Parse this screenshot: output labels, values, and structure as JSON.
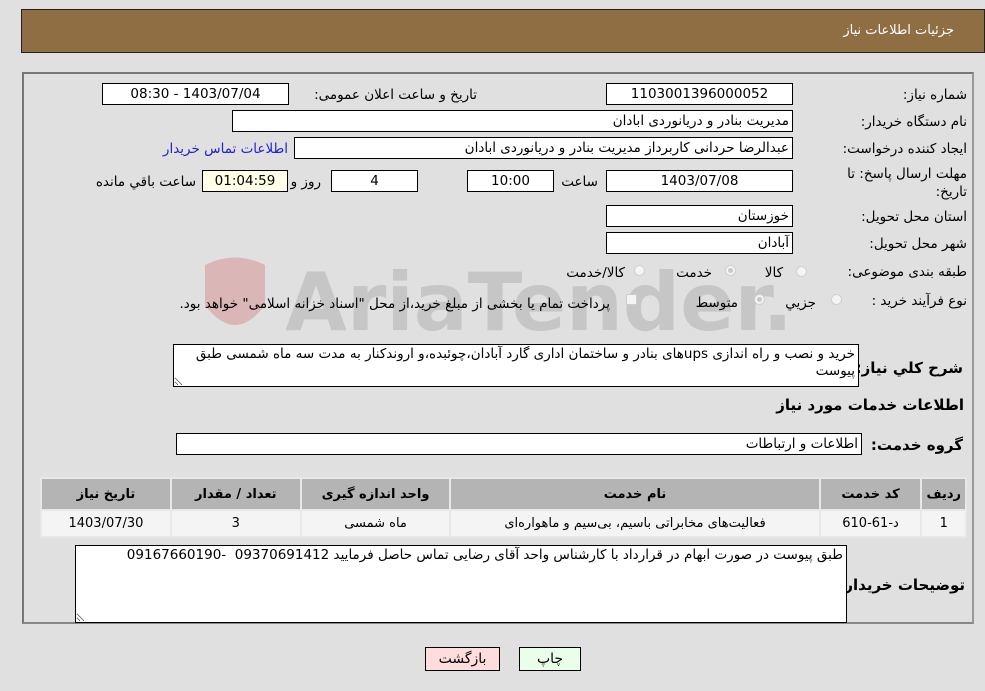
{
  "header": {
    "title": "جزئیات اطلاعات نیاز"
  },
  "form": {
    "need_number": {
      "label": "شماره نیاز:",
      "value": "1103001396000052"
    },
    "announce_datetime": {
      "label": "تاریخ و ساعت اعلان عمومی:",
      "value": "1403/07/04 - 08:30"
    },
    "buyer_org": {
      "label": "نام دستگاه خریدار:",
      "value": "مدیریت بنادر و دریانوردی ابادان"
    },
    "requester": {
      "label": "ایجاد کننده درخواست:",
      "value": "عبدالرضا حردانی کاربرداز مدیریت بنادر و دریانوردی ابادان",
      "contact_link": "اطلاعات تماس خریدار"
    },
    "deadline": {
      "label_line1": "مهلت ارسال پاسخ: تا",
      "label_line2": "تاریخ:",
      "date": "1403/07/08",
      "time_label": "ساعت",
      "time": "10:00",
      "days": "4",
      "days_label": "روز و",
      "remaining": "01:04:59",
      "remaining_label": "ساعت باقي مانده"
    },
    "province": {
      "label": "استان محل تحویل:",
      "value": "خوزستان"
    },
    "city": {
      "label": "شهر محل تحویل:",
      "value": "آبادان"
    },
    "category": {
      "label": "طبقه بندی موضوعی:",
      "options": [
        "کالا",
        "خدمت",
        "کالا/خدمت"
      ],
      "selected": "خدمت"
    },
    "purchase_type": {
      "label": "نوع فرآیند خرید :",
      "options": [
        "جزيي",
        "متوسط"
      ],
      "selected": "متوسط",
      "treasury_note": "پرداخت تمام یا بخشی از مبلغ خرید،از محل \"اسناد خزانه اسلامی\" خواهد بود."
    },
    "description": {
      "label": "شرح كلي نياز:",
      "value": "خرید و نصب و راه اندازی upsهای بنادر و ساختمان اداری گارد آبادان،چوئبده،و اروندکنار به مدت سه ماه شمسی طبق پیوست"
    }
  },
  "services": {
    "section_title": "اطلاعات خدمات مورد نیاز",
    "group_label": "گروه خدمت:",
    "group_value": "اطلاعات و ارتباطات",
    "columns": [
      "ردیف",
      "کد خدمت",
      "نام خدمت",
      "واحد اندازه گیری",
      "تعداد / مقدار",
      "تاریخ نیاز"
    ],
    "rows": [
      [
        "1",
        "د-61-610",
        "فعالیت‌های مخابراتی باسیم، بی‌سیم و ماهواره‌ای",
        "ماه شمسی",
        "3",
        "1403/07/30"
      ]
    ]
  },
  "buyer_notes": {
    "label": "توضیحات خریدار:",
    "value": "طبق پیوست در صورت ابهام در قرارداد با کارشناس واحد آقای رضایی تماس حاصل فرمایید 09370691412  -09167660190"
  },
  "buttons": {
    "print": "چاپ",
    "back": "بازگشت"
  },
  "colors": {
    "header_bg": "#8f6e43",
    "print_bg": "#eaffea",
    "back_bg": "#ffdddd",
    "link": "#2222cc"
  }
}
